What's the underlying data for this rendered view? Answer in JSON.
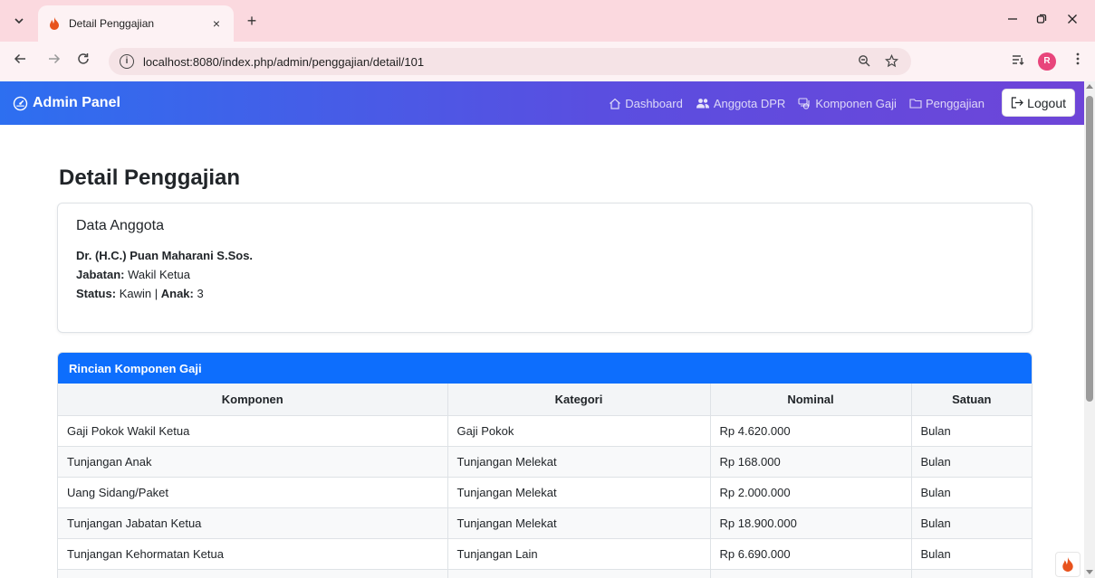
{
  "browser": {
    "tab_title": "Detail Penggajian",
    "tab_close": "×",
    "new_tab": "+",
    "url": "localhost:8080/index.php/admin/penggajian/detail/101",
    "info": "i",
    "avatar_letter": "R",
    "accent": "#fbd9df"
  },
  "navbar": {
    "brand": "Admin Panel",
    "links": [
      {
        "label": "Dashboard",
        "icon": "house-icon"
      },
      {
        "label": "Anggota DPR",
        "icon": "people-icon"
      },
      {
        "label": "Komponen Gaji",
        "icon": "cash-stack-icon"
      },
      {
        "label": "Penggajian",
        "icon": "folder-icon"
      }
    ],
    "logout": "Logout",
    "gradient_start": "#2d6ff0",
    "gradient_end": "#6e45d8"
  },
  "page": {
    "title": "Detail Penggajian"
  },
  "member": {
    "section_title": "Data Anggota",
    "name": "Dr. (H.C.) Puan Maharani S.Sos.",
    "jabatan_label": "Jabatan:",
    "jabatan": "Wakil Ketua",
    "status_label": "Status:",
    "status": "Kawin",
    "separator": "|",
    "anak_label": "Anak:",
    "anak": "3"
  },
  "table": {
    "header": "Rincian Komponen Gaji",
    "header_color": "#0d6efd",
    "columns": [
      "Komponen",
      "Kategori",
      "Nominal",
      "Satuan"
    ],
    "rows": [
      [
        "Gaji Pokok Wakil Ketua",
        "Gaji Pokok",
        "Rp 4.620.000",
        "Bulan"
      ],
      [
        "Tunjangan Anak",
        "Tunjangan Melekat",
        "Rp 168.000",
        "Bulan"
      ],
      [
        "Uang Sidang/Paket",
        "Tunjangan Melekat",
        "Rp 2.000.000",
        "Bulan"
      ],
      [
        "Tunjangan Jabatan Ketua",
        "Tunjangan Melekat",
        "Rp 18.900.000",
        "Bulan"
      ],
      [
        "Tunjangan Kehormatan Ketua",
        "Tunjangan Lain",
        "Rp 6.690.000",
        "Bulan"
      ]
    ]
  }
}
